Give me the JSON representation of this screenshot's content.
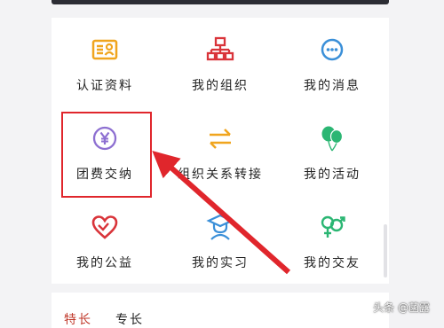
{
  "menu": {
    "items": [
      {
        "label": "认证资料",
        "icon": "id-card-icon"
      },
      {
        "label": "我的组织",
        "icon": "org-chart-icon"
      },
      {
        "label": "我的消息",
        "icon": "chat-bubble-icon"
      },
      {
        "label": "团费交纳",
        "icon": "yen-coin-icon"
      },
      {
        "label": "组织关系转接",
        "icon": "transfer-arrows-icon"
      },
      {
        "label": "我的活动",
        "icon": "balloons-icon"
      },
      {
        "label": "我的公益",
        "icon": "heart-icon"
      },
      {
        "label": "我的实习",
        "icon": "graduate-icon"
      },
      {
        "label": "我的交友",
        "icon": "gender-icon"
      }
    ]
  },
  "bottom": {
    "label1": "特长",
    "label2": "专长"
  },
  "watermark": "头条 @菡露",
  "colors": {
    "id_card": "#f0a51e",
    "org": "#d9343a",
    "chat": "#3a8fd8",
    "yen": "#8d6fd1",
    "transfer": "#f0a51e",
    "balloons": "#2bb673",
    "heart": "#d9343a",
    "graduate": "#3a8fd8",
    "gender": "#2bb673",
    "highlight": "#e0262c"
  }
}
